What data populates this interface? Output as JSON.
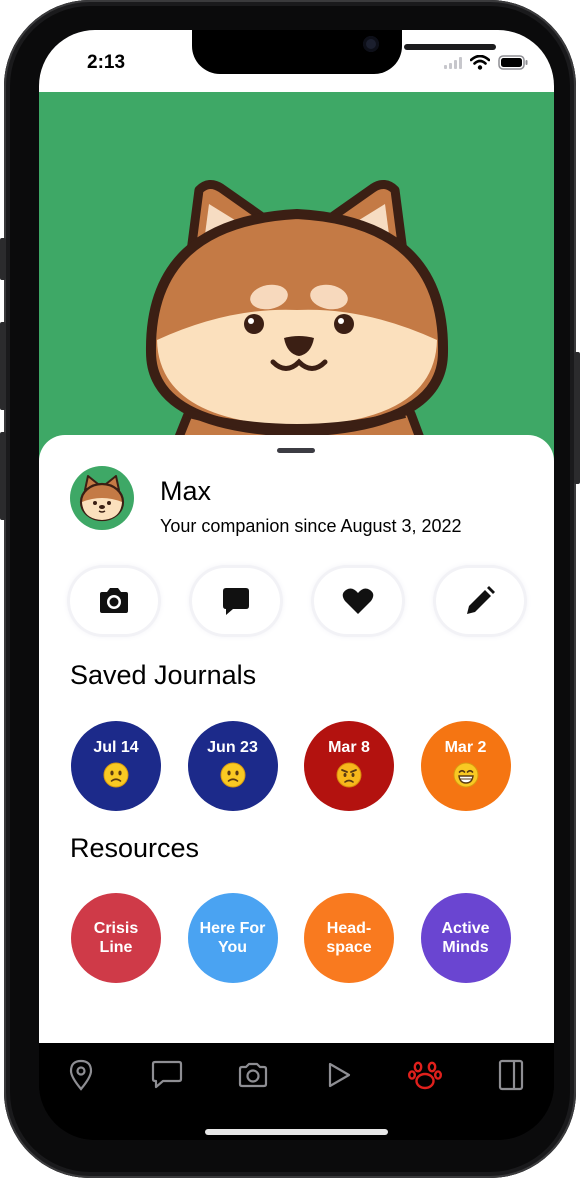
{
  "status_bar": {
    "time": "2:13"
  },
  "pet": {
    "name": "Max",
    "companion_text": "Your companion since August 3, 2022"
  },
  "quick_actions": [
    {
      "icon": "camera-icon"
    },
    {
      "icon": "chat-bubble-icon"
    },
    {
      "icon": "heart-icon"
    },
    {
      "icon": "pencil-icon"
    }
  ],
  "saved_journals": {
    "title": "Saved Journals",
    "items": [
      {
        "date": "Jul 14",
        "mood": "slightly-frowning",
        "color": "#1c2a8a"
      },
      {
        "date": "Jun 23",
        "mood": "slightly-frowning",
        "color": "#1c2a8a"
      },
      {
        "date": "Mar 8",
        "mood": "angry",
        "color": "#b3120f"
      },
      {
        "date": "Mar 2",
        "mood": "grinning",
        "color": "#f57512"
      }
    ]
  },
  "resources": {
    "title": "Resources",
    "items": [
      {
        "line1": "Crisis",
        "line2": "Line",
        "color": "#cf3a48"
      },
      {
        "line1": "Here For",
        "line2": "You",
        "color": "#4aa3f2"
      },
      {
        "line1": "Head-",
        "line2": "space",
        "color": "#f97a1f"
      },
      {
        "line1": "Active",
        "line2": "Minds",
        "color": "#6a45d1"
      }
    ]
  },
  "tab_bar": {
    "active_color": "#e0201c",
    "inactive_color": "#8e8e93",
    "tabs": [
      {
        "icon": "map-pin-icon",
        "active": false
      },
      {
        "icon": "chat-bubble-icon",
        "active": false
      },
      {
        "icon": "camera-icon",
        "active": false
      },
      {
        "icon": "play-icon",
        "active": false
      },
      {
        "icon": "paw-icon",
        "active": true
      },
      {
        "icon": "journal-icon",
        "active": false
      }
    ]
  },
  "colors": {
    "hero_background": "#3ea866"
  }
}
